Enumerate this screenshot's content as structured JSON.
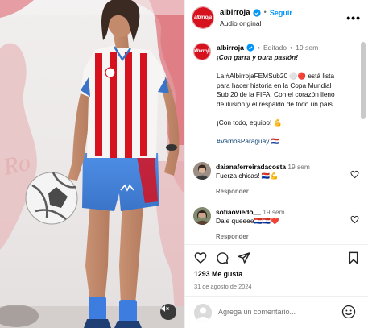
{
  "colors": {
    "brand_red": "#d6121f",
    "link_blue": "#0095f6",
    "hashtag_blue": "#00376b",
    "muted": "#737373"
  },
  "media": {
    "description_icon": "mute-icon",
    "brand_watermark": "albirroja"
  },
  "header": {
    "username": "albirroja",
    "separator": "•",
    "follow_label": "Seguir",
    "audio_label": "Audio original",
    "more_icon": "more-horizontal-icon",
    "more_label": "•••"
  },
  "post": {
    "username": "albirroja",
    "separator": "•",
    "edited_label": "Editado",
    "time": "19 sem",
    "caption": {
      "title": "¡Con garra y pura pasión!",
      "line1": "La #AlbirrojaFEMSub20 ⚪🔴 está lista",
      "line2": "para hacer historia en la Copa Mundial",
      "line3": "Sub 20 de la FIFA. Con el corazón lleno",
      "line4": "de ilusión y el respaldo de todo un país.",
      "closing": "¡Con todo, equipo! 💪",
      "hashtag": "#VamosParaguay",
      "flag": "🇵🇾"
    }
  },
  "comments": [
    {
      "username": "daianaferreiradacosta",
      "time": "19 sem",
      "text": "Fuerza chicas! 🇵🇾💪",
      "reply_label": "Responder"
    },
    {
      "username": "sofiaoviedo__",
      "time": "19 sem",
      "text": "Dale queeee🇵🇾🇵🇾❤️",
      "reply_label": "Responder"
    }
  ],
  "actions": {
    "likes": "1293 Me gusta",
    "date": "31 de agosto de 2024",
    "icons": [
      "heart-icon",
      "comment-icon",
      "share-icon",
      "bookmark-icon"
    ]
  },
  "add_comment": {
    "placeholder": "Agrega un comentario...",
    "emoji_icon": "emoji-icon"
  }
}
